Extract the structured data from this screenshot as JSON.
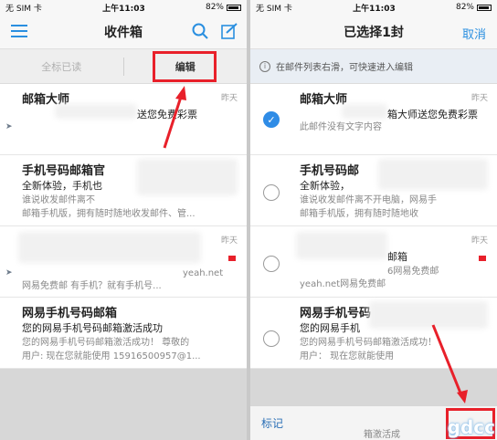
{
  "status": {
    "carrier": "无 SIM 卡",
    "time": "上午11:03",
    "battery": "82%"
  },
  "left": {
    "title": "收件箱",
    "toolbar": {
      "mark_all_read": "全标已读",
      "edit": "编辑"
    },
    "mails": [
      {
        "sender": "邮箱大师",
        "time": "昨天",
        "subject": "送您免费彩票",
        "preview1": "",
        "preview2": ""
      },
      {
        "sender": "手机号码邮箱官",
        "time": "",
        "subject": "全新体验，手机也",
        "preview1": "谁说收发邮件离不",
        "preview2": "邮箱手机版，拥有随时随地收发邮件、管..."
      },
      {
        "sender": "",
        "time": "昨天",
        "subject": "",
        "preview1": "yeah.net",
        "preview2": "网易免费邮          有手机？就有手机号..."
      },
      {
        "sender": "网易手机号码邮箱",
        "time": "",
        "subject": "您的网易手机号码邮箱激活成功",
        "preview1": "您的网易手机号码邮箱激活成功！ 尊敬的",
        "preview2": "用户:       现在您就能使用 15916500957@1..."
      }
    ]
  },
  "right": {
    "title": "已选择1封",
    "cancel": "取消",
    "hint": "在邮件列表右滑，可快速进入编辑",
    "bottom": {
      "mark": "标记"
    },
    "mails": [
      {
        "sender": "邮箱大师",
        "time": "昨天",
        "subject": "箱大师送您免费彩票",
        "preview1": "此邮件没有文字内容",
        "preview2": ""
      },
      {
        "sender": "手机号码邮",
        "time": "",
        "subject": "全新体验，",
        "preview1": "谁说收发邮件离不开电脑，网易手",
        "preview2": "邮箱手机版，拥有随时随地收"
      },
      {
        "sender": "",
        "time": "昨天",
        "subject": "邮箱",
        "preview1": "6网易免费邮",
        "preview2": "yeah.net网易免费邮"
      },
      {
        "sender": "网易手机号码",
        "time": "",
        "subject": "您的网易手机",
        "preview1": "您的网易手机号码邮箱激活成功！",
        "preview2": "用户：    现在您就能使用"
      }
    ],
    "footer_preview": "箱激活成"
  },
  "watermark": "gdcc"
}
